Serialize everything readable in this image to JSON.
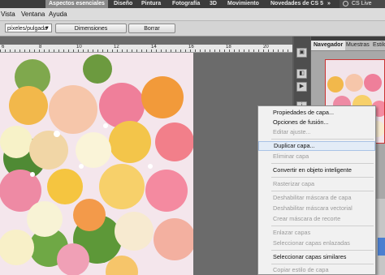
{
  "workspace_bar": {
    "active": "Aspectos esenciales",
    "items": [
      "Diseño",
      "Pintura",
      "Fotografía",
      "3D",
      "Movimiento",
      "Novedades de CS 5"
    ],
    "more": "»",
    "cs_live": "CS Live"
  },
  "menu_bar": [
    "Vista",
    "Ventana",
    "Ayuda"
  ],
  "options_bar": {
    "unit": "píxeles/pulgada",
    "dimensions_button": "Dimensiones",
    "clear_button": "Borrar"
  },
  "ruler": {
    "labels": [
      "6",
      "8",
      "10",
      "12",
      "14",
      "16",
      "18",
      "20"
    ]
  },
  "panel": {
    "tabs": [
      "Navegador",
      "Muestras",
      "Estilos"
    ],
    "strip_icons": [
      "navigator-icon",
      "history-icon",
      "actions-icon",
      "info-icon"
    ]
  },
  "context_menu": {
    "items": [
      {
        "label": "Propiedades de capa...",
        "enabled": true
      },
      {
        "label": "Opciones de fusión...",
        "enabled": true
      },
      {
        "label": "Editar ajuste...",
        "enabled": false
      },
      {
        "label": "Duplicar capa...",
        "enabled": true,
        "highlighted": true
      },
      {
        "label": "Eliminar capa",
        "enabled": false
      },
      {
        "label": "Convertir en objeto inteligente",
        "enabled": true
      },
      {
        "label": "Rasterizar capa",
        "enabled": false
      },
      {
        "label": "Deshabilitar máscara de capa",
        "enabled": false
      },
      {
        "label": "Deshabilitar máscara vectorial",
        "enabled": false
      },
      {
        "label": "Crear máscara de recorte",
        "enabled": false
      },
      {
        "label": "Enlazar capas",
        "enabled": false
      },
      {
        "label": "Seleccionar capas enlazadas",
        "enabled": false
      },
      {
        "label": "Seleccionar capas similares",
        "enabled": true
      },
      {
        "label": "Copiar estilo de capa",
        "enabled": false
      }
    ]
  },
  "colors": {
    "highlight": "#e3ecf7",
    "disabled_text": "#9a9a9a",
    "accent_blue": "#4b7fd0"
  }
}
